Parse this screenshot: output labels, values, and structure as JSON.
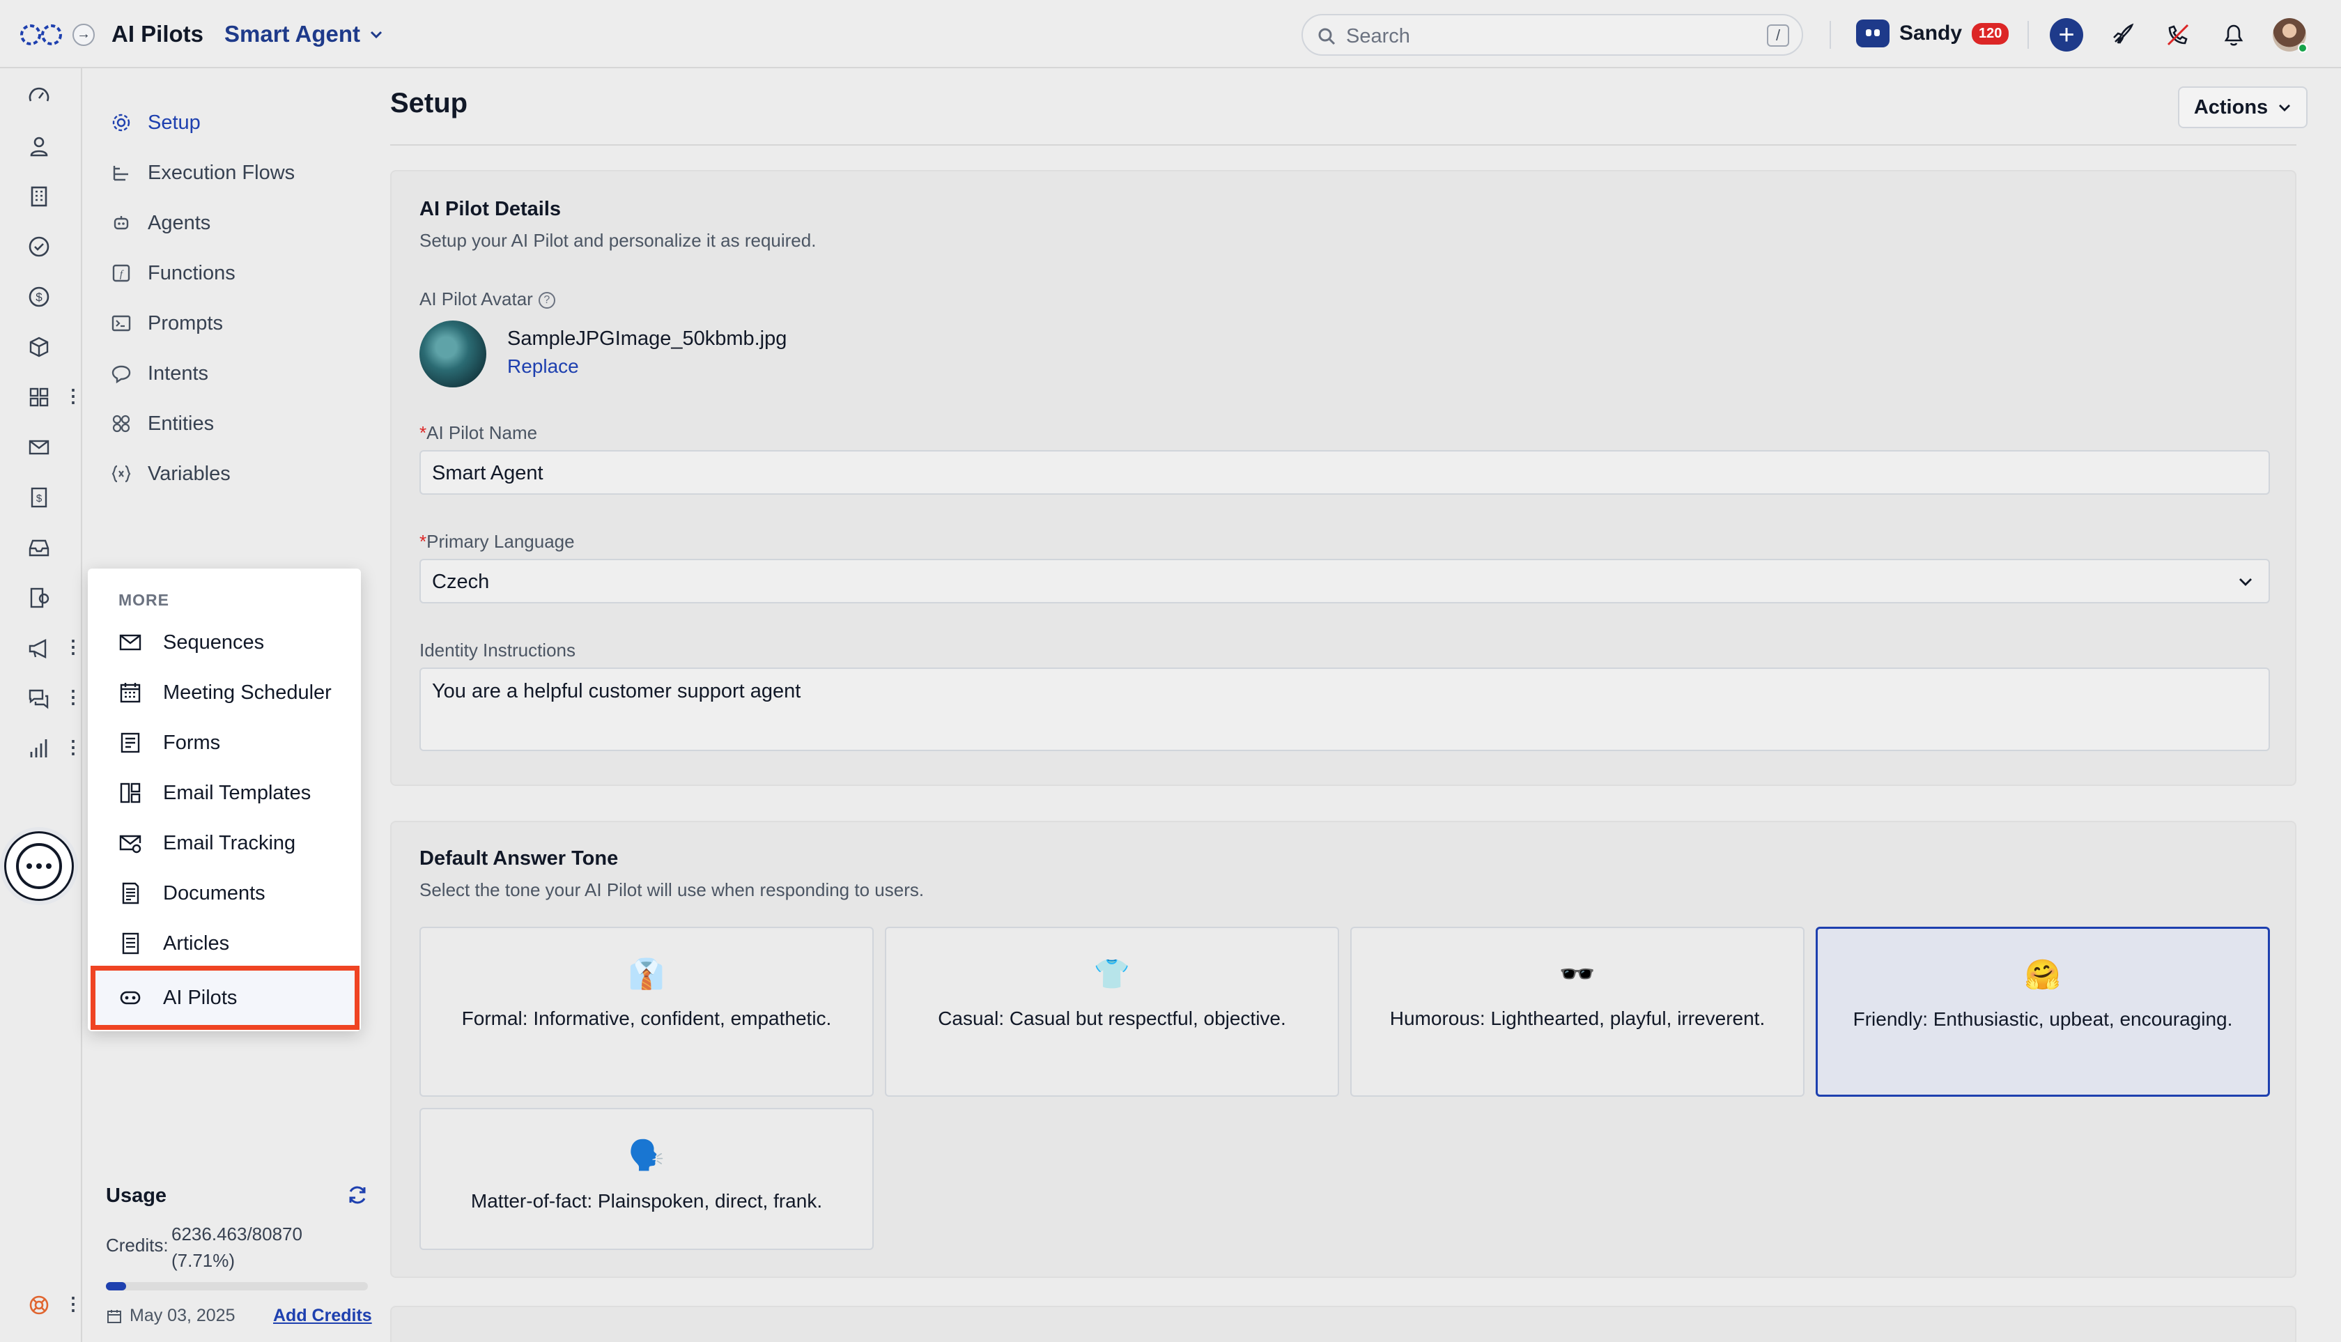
{
  "topbar": {
    "app_title": "AI Pilots",
    "agent_name": "Smart Agent",
    "search_placeholder": "Search",
    "search_shortcut": "/",
    "user_name": "Sandy",
    "user_badge": "120"
  },
  "subnav": {
    "items": [
      {
        "label": "Setup",
        "icon": "gear-icon",
        "active": true
      },
      {
        "label": "Execution Flows",
        "icon": "flow-icon"
      },
      {
        "label": "Agents",
        "icon": "agents-icon"
      },
      {
        "label": "Functions",
        "icon": "function-icon"
      },
      {
        "label": "Prompts",
        "icon": "prompt-icon"
      },
      {
        "label": "Intents",
        "icon": "chat-bubble-icon"
      },
      {
        "label": "Entities",
        "icon": "entities-icon"
      },
      {
        "label": "Variables",
        "icon": "variables-icon"
      }
    ]
  },
  "usage": {
    "title": "Usage",
    "credits_label": "Credits:",
    "credits_value": "6236.463/80870",
    "credits_percent": "(7.71%)",
    "fill_fraction": 0.0771,
    "date": "May 03, 2025",
    "add_credits": "Add Credits"
  },
  "main": {
    "page_title": "Setup",
    "actions_label": "Actions"
  },
  "details": {
    "title": "AI Pilot Details",
    "subtitle": "Setup your AI Pilot and personalize it as required.",
    "avatar_label": "AI Pilot Avatar",
    "file_name": "SampleJPGImage_50kbmb.jpg",
    "replace_label": "Replace",
    "name_label": "AI Pilot Name",
    "name_value": "Smart Agent",
    "language_label": "Primary Language",
    "language_value": "Czech",
    "identity_label": "Identity Instructions",
    "identity_value": "You are a helpful customer support agent",
    "required_mark": "*"
  },
  "tone": {
    "title": "Default Answer Tone",
    "subtitle": "Select the tone your AI Pilot will use when responding to users.",
    "options": [
      {
        "emoji": "👔",
        "text": "Formal: Informative, confident, empathetic."
      },
      {
        "emoji": "👕",
        "text": "Casual: Casual but respectful, objective."
      },
      {
        "emoji": "🕶️",
        "text": "Humorous: Lighthearted, playful, irreverent."
      },
      {
        "emoji": "🤗",
        "text": "Friendly: Enthusiastic, upbeat, encouraging.",
        "selected": true
      },
      {
        "emoji": "🗣️",
        "text": "Matter-of-fact: Plainspoken, direct, frank."
      }
    ]
  },
  "more_menu": {
    "header": "MORE",
    "items": [
      {
        "label": "Sequences",
        "icon": "envelope-icon"
      },
      {
        "label": "Meeting Scheduler",
        "icon": "calendar-icon"
      },
      {
        "label": "Forms",
        "icon": "form-icon"
      },
      {
        "label": "Email Templates",
        "icon": "template-icon"
      },
      {
        "label": "Email Tracking",
        "icon": "email-tracking-icon"
      },
      {
        "label": "Documents",
        "icon": "document-icon"
      },
      {
        "label": "Articles",
        "icon": "article-icon"
      },
      {
        "label": "AI Pilots",
        "icon": "ai-pilot-icon",
        "highlighted": true
      }
    ]
  },
  "colors": {
    "accent": "#1e40af",
    "highlight": "#ef4423",
    "badge": "#dc2626"
  }
}
